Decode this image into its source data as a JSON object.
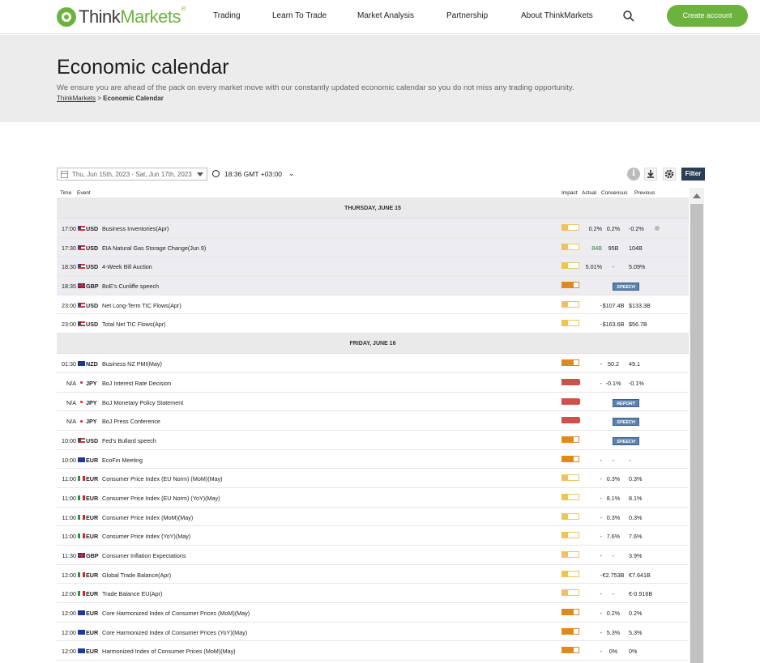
{
  "nav": {
    "logo_think": "Think",
    "logo_markets": "Markets",
    "logo_reg": "®",
    "items": [
      "Trading",
      "Learn To Trade",
      "Market Analysis",
      "Partnership",
      "About ThinkMarkets"
    ],
    "cta": "Create account",
    "brand_color": "#6cb33e"
  },
  "banner": {
    "title": "Economic calendar",
    "subtitle": "We ensure you are ahead of the pack on every market move with our constantly updated economic calendar so you do not miss any trading opportunity.",
    "crumb_home": "ThinkMarkets",
    "crumb_sep": ">",
    "crumb_current": "Economic Calendar"
  },
  "toolbar": {
    "date_range": "Thu, Jun 15th, 2023 -  Sat, Jun 17th, 2023",
    "timezone": "18:36 GMT +03:00",
    "filter": "Filter",
    "info_glyph": "i"
  },
  "table": {
    "headers": {
      "time": "Time",
      "event": "Event",
      "impact": "Impact",
      "actual": "Actual",
      "consensus": "Consensus",
      "previous": "Previous"
    },
    "days": [
      {
        "label": "THURSDAY, JUNE 15",
        "rows": [
          {
            "time": "17:00",
            "flag": "us",
            "cur": "USD",
            "event": "Business Inventories(Apr)",
            "impact": "low",
            "actual": "0.2%",
            "consensus": "0.2%",
            "previous": "-0.2%",
            "prev_info": true,
            "shaded": true
          },
          {
            "time": "17:30",
            "flag": "us",
            "cur": "USD",
            "event": "EIA Natural Gas Storage Change(Jun 9)",
            "impact": "low",
            "actual": "84B",
            "actual_color": "#2f7d3a",
            "consensus": "95B",
            "previous": "104B",
            "shaded": true
          },
          {
            "time": "18:30",
            "flag": "us",
            "cur": "USD",
            "event": "4-Week Bill Auction",
            "impact": "low",
            "actual": "5.01%",
            "consensus": "-",
            "previous": "5.09%",
            "shaded": true
          },
          {
            "time": "18:35",
            "flag": "gb",
            "cur": "GBP",
            "event": "BoE's Cunliffe speech",
            "impact": "medium",
            "badge": "SPEECH",
            "shaded": true
          },
          {
            "time": "23:00",
            "flag": "us",
            "cur": "USD",
            "event": "Net Long-Term TIC Flows(Apr)",
            "impact": "low",
            "actual": "-",
            "consensus": "$107.4B",
            "previous": "$133.3B"
          },
          {
            "time": "23:00",
            "flag": "us",
            "cur": "USD",
            "event": "Total Net TIC Flows(Apr)",
            "impact": "low",
            "actual": "-",
            "consensus": "$163.6B",
            "previous": "$56.7B"
          }
        ]
      },
      {
        "label": "FRIDAY, JUNE 16",
        "rows": [
          {
            "time": "01:30",
            "flag": "nz",
            "cur": "NZD",
            "event": "Business NZ PMI(May)",
            "impact": "medium",
            "actual": "-",
            "consensus": "50.2",
            "previous": "49.1"
          },
          {
            "time": "N/A",
            "flag": "jp",
            "cur": "JPY",
            "event": "BoJ Interest Rate Decision",
            "impact": "high",
            "actual": "-",
            "consensus": "-0.1%",
            "previous": "-0.1%"
          },
          {
            "time": "N/A",
            "flag": "jp",
            "cur": "JPY",
            "event": "BoJ Monetary Policy Statement",
            "impact": "high",
            "badge": "REPORT"
          },
          {
            "time": "N/A",
            "flag": "jp",
            "cur": "JPY",
            "event": "BoJ Press Conference",
            "impact": "high",
            "badge": "SPEECH"
          },
          {
            "time": "10:00",
            "flag": "us",
            "cur": "USD",
            "event": "Fed's Bullard speech",
            "impact": "medium",
            "badge": "SPEECH"
          },
          {
            "time": "10:00",
            "flag": "eu",
            "cur": "EUR",
            "event": "EcoFin Meeting",
            "impact": "medium",
            "actual": "-",
            "consensus": "-",
            "previous": "-"
          },
          {
            "time": "11:00",
            "flag": "it",
            "cur": "EUR",
            "event": "Consumer Price Index (EU Norm) (MoM)(May)",
            "impact": "low",
            "actual": "-",
            "consensus": "0.3%",
            "previous": "0.3%"
          },
          {
            "time": "11:00",
            "flag": "it",
            "cur": "EUR",
            "event": "Consumer Price Index (EU Norm) (YoY)(May)",
            "impact": "low",
            "actual": "-",
            "consensus": "8.1%",
            "previous": "8.1%"
          },
          {
            "time": "11:00",
            "flag": "it",
            "cur": "EUR",
            "event": "Consumer Price Index (MoM)(May)",
            "impact": "low",
            "actual": "-",
            "consensus": "0.3%",
            "previous": "0.3%"
          },
          {
            "time": "11:00",
            "flag": "it",
            "cur": "EUR",
            "event": "Consumer Price Index (YoY)(May)",
            "impact": "low",
            "actual": "-",
            "consensus": "7.6%",
            "previous": "7.6%"
          },
          {
            "time": "11:30",
            "flag": "gb",
            "cur": "GBP",
            "event": "Consumer Inflation Expectations",
            "impact": "low",
            "actual": "-",
            "consensus": "-",
            "previous": "3.9%"
          },
          {
            "time": "12:00",
            "flag": "it",
            "cur": "EUR",
            "event": "Global Trade Balance(Apr)",
            "impact": "low",
            "actual": "-",
            "consensus": "€2.753B",
            "previous": "€7.641B"
          },
          {
            "time": "12:00",
            "flag": "it",
            "cur": "EUR",
            "event": "Trade Balance EU(Apr)",
            "impact": "low",
            "actual": "-",
            "consensus": "-",
            "previous": "€-0.916B"
          },
          {
            "time": "12:00",
            "flag": "eu",
            "cur": "EUR",
            "event": "Core Harmonized Index of Consumer Prices (MoM)(May)",
            "impact": "medium",
            "actual": "-",
            "consensus": "0.2%",
            "previous": "0.2%"
          },
          {
            "time": "12:00",
            "flag": "eu",
            "cur": "EUR",
            "event": "Core Harmonized Index of Consumer Prices (YoY)(May)",
            "impact": "medium",
            "actual": "-",
            "consensus": "5.3%",
            "previous": "5.3%"
          },
          {
            "time": "12:00",
            "flag": "eu",
            "cur": "EUR",
            "event": "Harmonized Index of Consumer Prices (MoM)(May)",
            "impact": "medium",
            "actual": "-",
            "consensus": "0%",
            "previous": "0%"
          }
        ]
      }
    ],
    "impact_colors": {
      "low": "#f0c35a",
      "medium": "#e08a1e",
      "high": "#d0504a",
      "border": "#f0c35a"
    }
  }
}
